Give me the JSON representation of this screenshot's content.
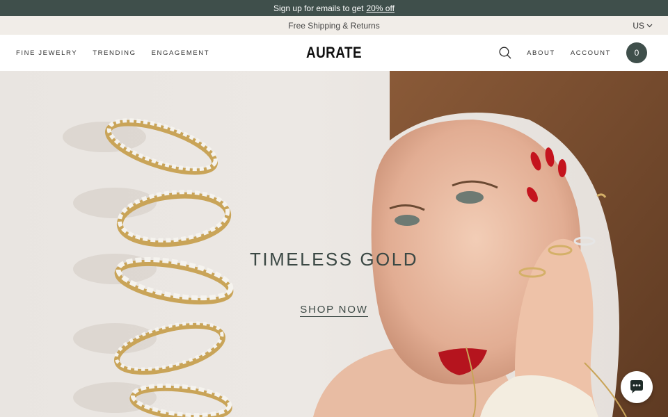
{
  "promo": {
    "text": "Sign up for emails to get",
    "link": "20% off"
  },
  "shipping": {
    "text": "Free Shipping & Returns",
    "region": "US"
  },
  "nav": {
    "left": [
      "FINE JEWELRY",
      "TRENDING",
      "ENGAGEMENT"
    ],
    "logo": "AURATE",
    "right": [
      "ABOUT",
      "ACCOUNT"
    ],
    "cart_count": "0"
  },
  "hero": {
    "title": "TIMELESS GOLD",
    "cta": "SHOP NOW"
  },
  "colors": {
    "accent": "#3f4f4b",
    "gold": "#c9a458"
  }
}
